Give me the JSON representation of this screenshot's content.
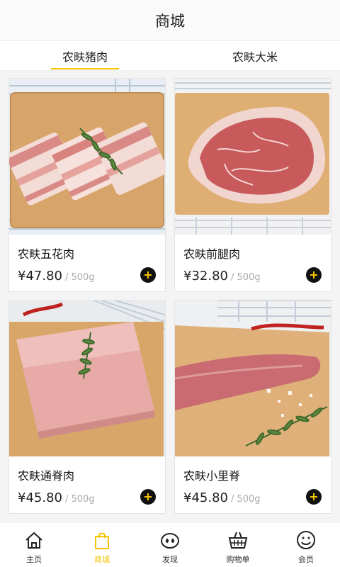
{
  "header": {
    "title": "商城"
  },
  "tabs": [
    {
      "label": "农畉猪肉",
      "active": true
    },
    {
      "label": "农畉大米",
      "active": false
    }
  ],
  "products": [
    {
      "name": "农畉五花肉",
      "price": "¥47.80",
      "unit": "/ 500g",
      "image": "pork-belly"
    },
    {
      "name": "农畉前腿肉",
      "price": "¥32.80",
      "unit": "/ 500g",
      "image": "pork-shoulder"
    },
    {
      "name": "农畉通脊肉",
      "price": "¥45.80",
      "unit": "/ 500g",
      "image": "pork-loin"
    },
    {
      "name": "农畉小里脊",
      "price": "¥45.80",
      "unit": "/ 500g",
      "image": "pork-tenderloin"
    }
  ],
  "tabbar": [
    {
      "label": "主页",
      "icon": "home-icon",
      "active": false
    },
    {
      "label": "商城",
      "icon": "shopping-bag-icon",
      "active": true
    },
    {
      "label": "发现",
      "icon": "discover-icon",
      "active": false
    },
    {
      "label": "购物单",
      "icon": "basket-icon",
      "active": false
    },
    {
      "label": "会员",
      "icon": "member-smile-icon",
      "active": false
    }
  ],
  "colors": {
    "accent": "#f5c300",
    "text": "#222222",
    "muted": "#aaaaaa"
  }
}
